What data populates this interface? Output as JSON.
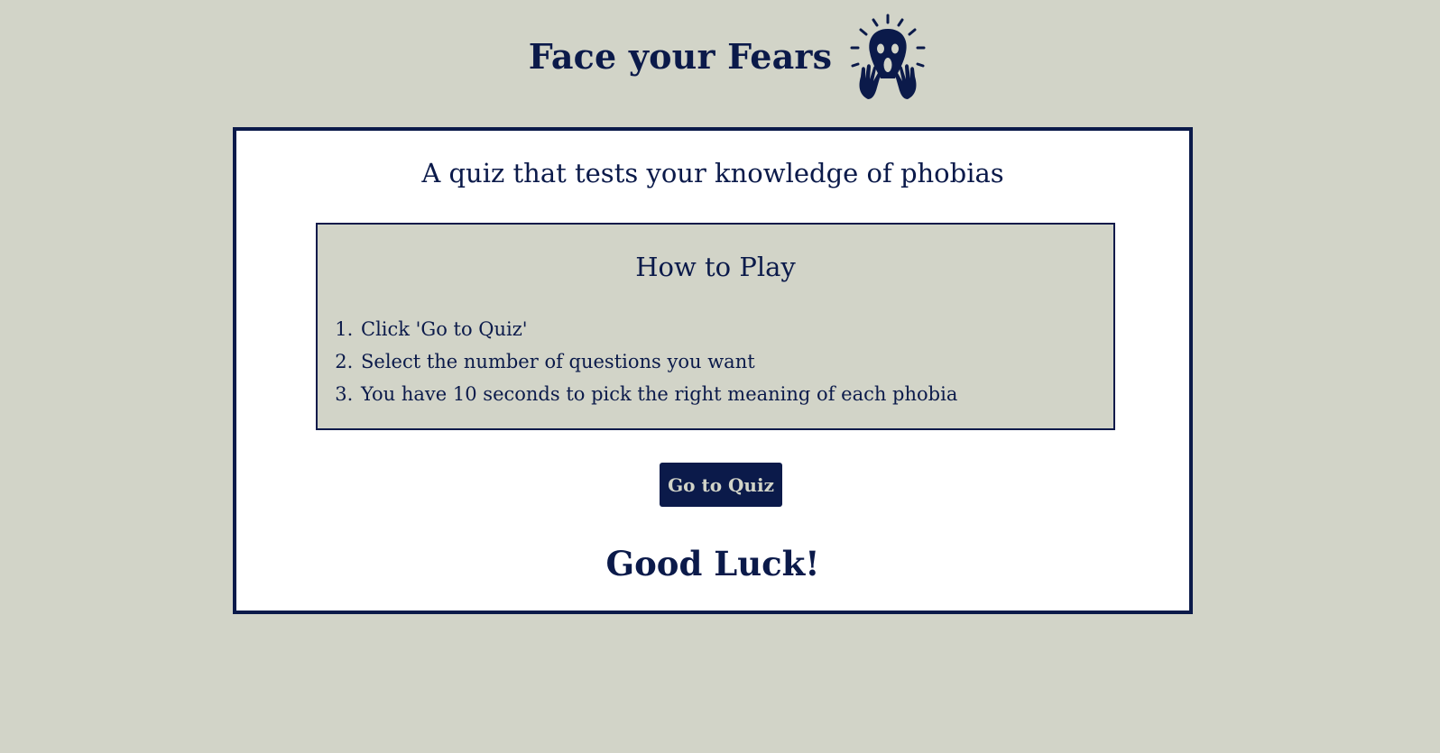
{
  "header": {
    "title": "Face your Fears",
    "icon": "screaming-face-icon"
  },
  "main": {
    "subtitle": "A quiz that tests your knowledge of phobias",
    "how_to_play": {
      "title": "How to Play",
      "steps": [
        "Click 'Go to Quiz'",
        "Select the number of questions you want",
        "You have 10 seconds to pick the right meaning of each phobia"
      ]
    },
    "go_button_label": "Go to Quiz",
    "good_luck": "Good Luck!"
  },
  "colors": {
    "background": "#d2d4c8",
    "primary": "#0b1a4a",
    "card": "#ffffff"
  }
}
